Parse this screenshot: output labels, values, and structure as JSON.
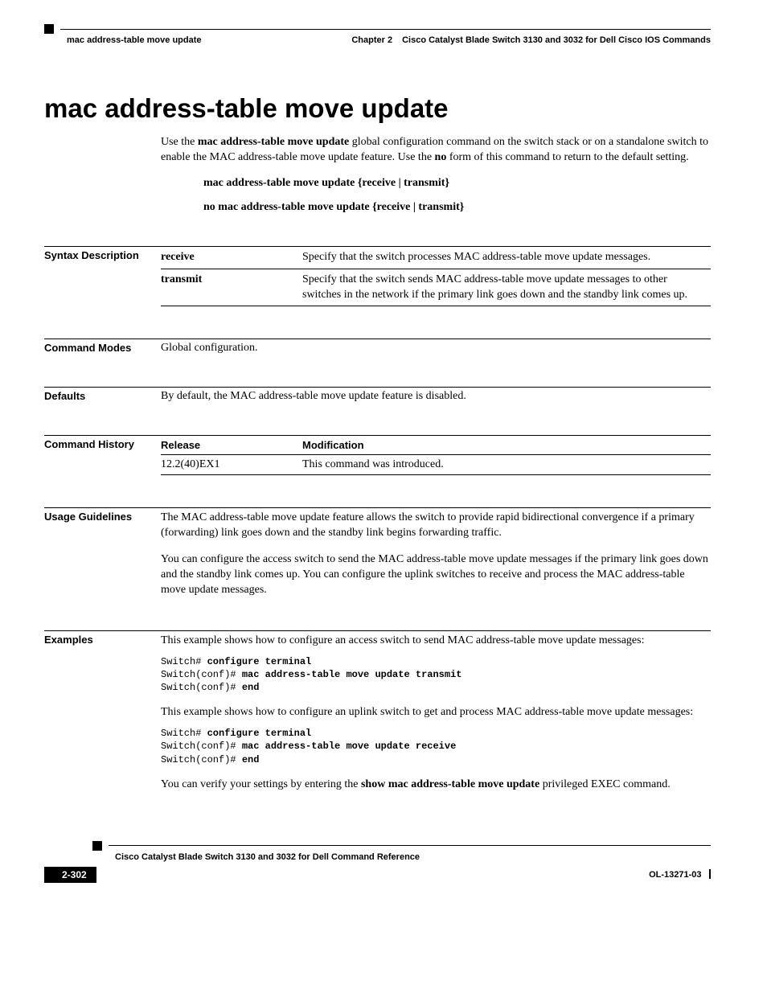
{
  "header": {
    "breadcrumb": "mac address-table move update",
    "chapter": "Chapter 2",
    "chapter_title": "Cisco Catalyst Blade Switch 3130 and 3032 for Dell Cisco IOS Commands"
  },
  "title": "mac address-table move update",
  "intro": {
    "pre1": "Use the ",
    "bold1": "mac address-table move update",
    "mid1": " global configuration command on the switch stack or on a standalone switch to enable the MAC address-table move update feature. Use the ",
    "bold2": "no",
    "post1": " form of this command to return to the default setting."
  },
  "syntax1": "mac address-table move update {receive | transmit}",
  "syntax2": "no mac address-table move update {receive | transmit}",
  "labels": {
    "syntax": "Syntax Description",
    "modes": "Command Modes",
    "defaults": "Defaults",
    "history": "Command History",
    "guidelines": "Usage Guidelines",
    "examples": "Examples"
  },
  "syntax_rows": [
    {
      "kw": "receive",
      "desc": "Specify that the switch processes MAC address-table move update messages."
    },
    {
      "kw": "transmit",
      "desc": "Specify that the switch sends MAC address-table move update messages to other switches in the network if the primary link goes down and the standby link comes up."
    }
  ],
  "modes_text": "Global configuration.",
  "defaults_text": "By default, the MAC address-table move update feature is disabled.",
  "history": {
    "h_release": "Release",
    "h_mod": "Modification",
    "rows": [
      {
        "rel": "12.2(40)EX1",
        "mod": "This command was introduced."
      }
    ]
  },
  "guidelines": {
    "p1": "The MAC address-table move update feature allows the switch to provide rapid bidirectional convergence if a primary (forwarding) link goes down and the standby link begins forwarding traffic.",
    "p2": "You can configure the access switch to send the MAC address-table move update messages if the primary link goes down and the standby link comes up. You can configure the uplink switches to receive and process the MAC address-table move update messages."
  },
  "examples": {
    "p1": "This example shows how to configure an access switch to send MAC address-table move update messages:",
    "cli1": {
      "l1a": "Switch# ",
      "l1b": "configure terminal",
      "l2a": "Switch(conf)# ",
      "l2b": "mac address-table move update transmit",
      "l3a": "Switch(conf)# ",
      "l3b": "end"
    },
    "p2": "This example shows how to configure an uplink switch to get and process MAC address-table move update messages:",
    "cli2": {
      "l1a": "Switch# ",
      "l1b": "configure terminal",
      "l2a": "Switch(conf)# ",
      "l2b": "mac address-table move update receive",
      "l3a": "Switch(conf)# ",
      "l3b": "end"
    },
    "p3_pre": "You can verify your settings by entering the ",
    "p3_bold": "show mac address-table move update",
    "p3_post": " privileged EXEC command."
  },
  "footer": {
    "book": "Cisco Catalyst Blade Switch 3130 and 3032 for Dell Command Reference",
    "page": "2-302",
    "docid": "OL-13271-03"
  }
}
